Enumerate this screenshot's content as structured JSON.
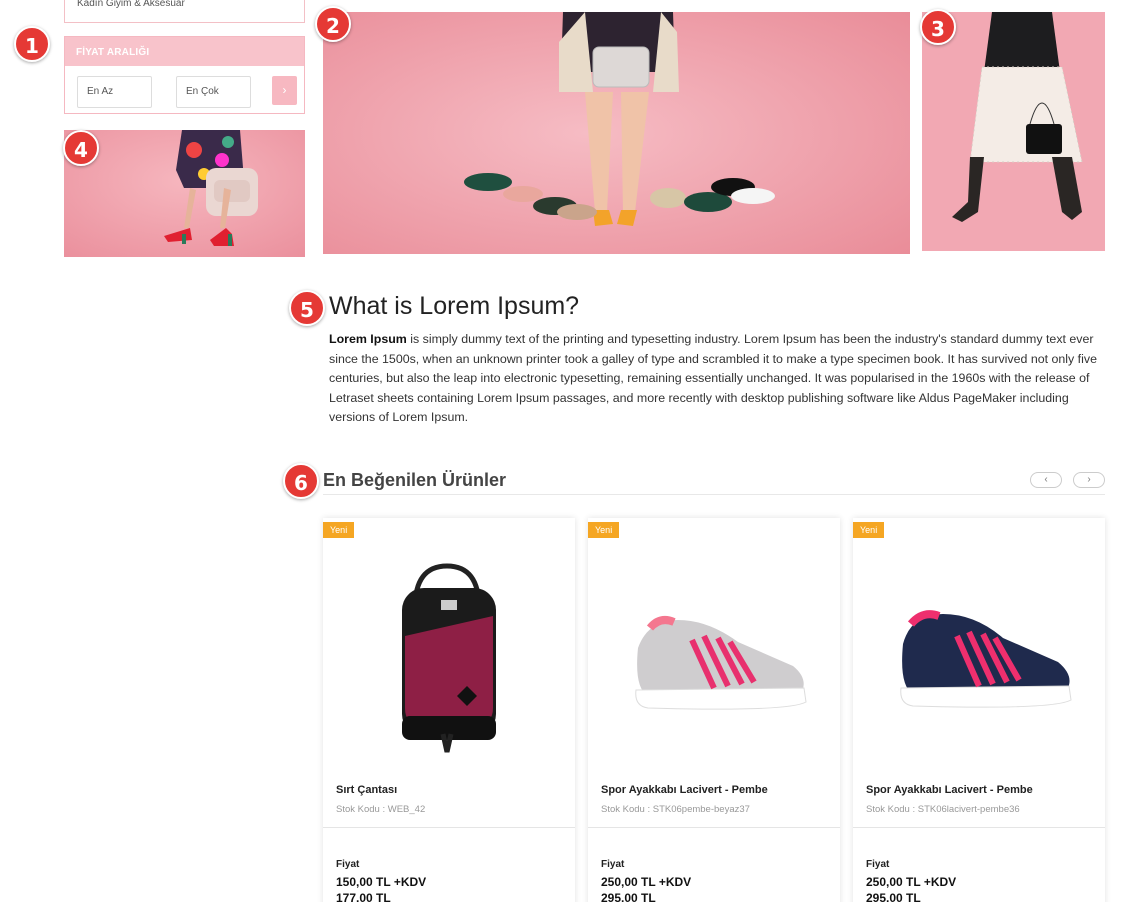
{
  "sidebar": {
    "category_label": "Kadın Giyim & Aksesuar",
    "price_range": {
      "title": "FİYAT ARALIĞI",
      "min_placeholder": "En Az",
      "max_placeholder": "En Çok",
      "submit_icon": "chevron-right-icon"
    }
  },
  "annotations": [
    "1",
    "2",
    "3",
    "4",
    "5",
    "6"
  ],
  "article": {
    "title": "What is Lorem Ipsum?",
    "lead_bold": "Lorem Ipsum",
    "body": " is simply dummy text of the printing and typesetting industry. Lorem Ipsum has been the industry's standard dummy text ever since the 1500s, when an unknown printer took a galley of type and scrambled it to make a type specimen book. It has survived not only five centuries, but also the leap into electronic typesetting, remaining essentially unchanged. It was popularised in the 1960s with the release of Letraset sheets containing Lorem Ipsum passages, and more recently with desktop publishing software like Aldus PageMaker including versions of Lorem Ipsum."
  },
  "products_section": {
    "title": "En Beğenilen Ürünler",
    "prev_icon": "chevron-left-icon",
    "next_icon": "chevron-right-icon",
    "products": [
      {
        "badge": "Yeni",
        "name": "Sırt Çantası",
        "sku": "Stok Kodu : WEB_42",
        "price_label": "Fiyat",
        "price": "150,00 TL +KDV",
        "price_incl": "177,00 TL",
        "image": "backpack-image"
      },
      {
        "badge": "Yeni",
        "name": "Spor Ayakkabı Lacivert - Pembe",
        "sku": "Stok Kodu : STK06pembe-beyaz37",
        "price_label": "Fiyat",
        "price": "250,00 TL +KDV",
        "price_incl": "295,00 TL",
        "image": "grey-pink-sneaker-image"
      },
      {
        "badge": "Yeni",
        "name": "Spor Ayakkabı Lacivert - Pembe",
        "sku": "Stok Kodu : STK06lacivert-pembe36",
        "price_label": "Fiyat",
        "price": "250,00 TL +KDV",
        "price_incl": "295,00 TL",
        "image": "navy-pink-sneaker-image"
      }
    ]
  },
  "colors": {
    "pink_banner": "#f2a7b2",
    "badge_red": "#e53935",
    "new_badge": "#f5a623",
    "price_header": "#f8c3cb"
  }
}
